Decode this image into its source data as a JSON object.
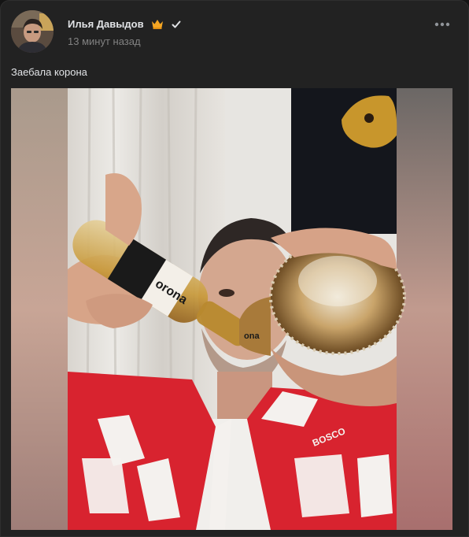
{
  "post": {
    "author": {
      "name": "Илья Давыдов",
      "avatar": "avatar-photo",
      "badges": [
        "crown-icon",
        "verified-checkmark-icon"
      ]
    },
    "time": "13 минут назад",
    "more_menu_icon": "more-horizontal-icon",
    "text": "Заебала корона",
    "photo": {
      "description_icon": "post-photo",
      "bottle_label_left": "orona",
      "bottle_label_right": "ona",
      "jacket_text_right": "BOSCO"
    }
  },
  "colors": {
    "card_background": "#222222",
    "text_primary": "#e1e3e6",
    "text_secondary": "#828282",
    "crown": "#f5a623",
    "jacket_red": "#d8232f"
  }
}
